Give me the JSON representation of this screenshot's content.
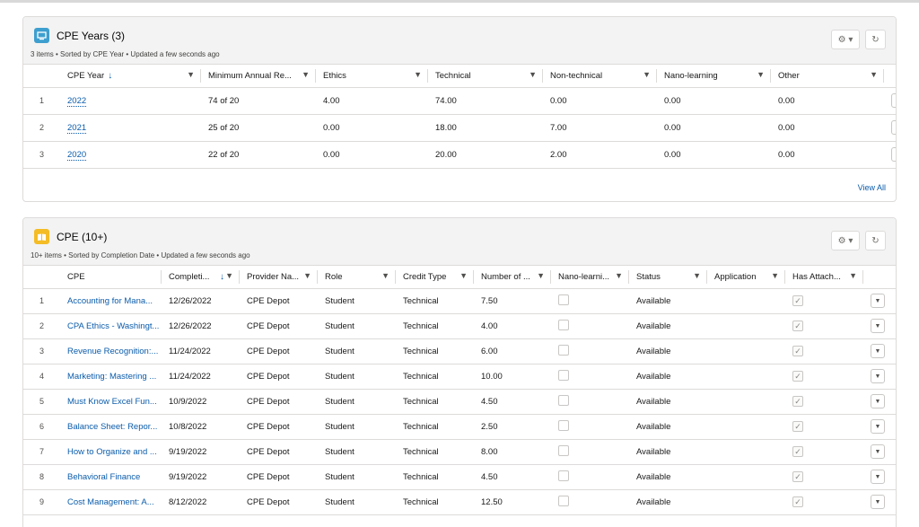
{
  "years_card": {
    "title": "CPE Years (3)",
    "subtitle": "3 items • Sorted by CPE Year • Updated a few seconds ago",
    "icon": "desktop-icon",
    "icon_color": "#3d9fcf",
    "settings_label": "⚙ ▾",
    "refresh_label": "↻",
    "columns": [
      "CPE Year",
      "Minimum Annual Re...",
      "Ethics",
      "Technical",
      "Non-technical",
      "Nano-learning",
      "Other"
    ],
    "sort_arrow": "↓",
    "rows": [
      {
        "num": "1",
        "year": "2022",
        "min": "74 of 20",
        "ethics": "4.00",
        "technical": "74.00",
        "nontech": "0.00",
        "nano": "0.00",
        "other": "0.00"
      },
      {
        "num": "2",
        "year": "2021",
        "min": "25 of 20",
        "ethics": "0.00",
        "technical": "18.00",
        "nontech": "7.00",
        "nano": "0.00",
        "other": "0.00"
      },
      {
        "num": "3",
        "year": "2020",
        "min": "22 of 20",
        "ethics": "0.00",
        "technical": "20.00",
        "nontech": "2.00",
        "nano": "0.00",
        "other": "0.00"
      }
    ],
    "view_all": "View All"
  },
  "cpe_card": {
    "title": "CPE (10+)",
    "subtitle": "10+ items • Sorted by Completion Date • Updated a few seconds ago",
    "icon": "book-icon",
    "icon_color": "#f4bc25",
    "settings_label": "⚙ ▾",
    "refresh_label": "↻",
    "columns": [
      "CPE",
      "Completi...",
      "Provider Na...",
      "Role",
      "Credit Type",
      "Number of ...",
      "Nano-learni...",
      "Status",
      "Application",
      "Has Attach..."
    ],
    "sort_arrow": "↓",
    "rows": [
      {
        "num": "1",
        "cpe": "Accounting for Mana...",
        "date": "12/26/2022",
        "provider": "CPE Depot",
        "role": "Student",
        "credit": "Technical",
        "number": "7.50",
        "nano": false,
        "status": "Available",
        "app": "",
        "attach": true
      },
      {
        "num": "2",
        "cpe": "CPA Ethics - Washingt...",
        "date": "12/26/2022",
        "provider": "CPE Depot",
        "role": "Student",
        "credit": "Technical",
        "number": "4.00",
        "nano": false,
        "status": "Available",
        "app": "",
        "attach": true
      },
      {
        "num": "3",
        "cpe": "Revenue Recognition:...",
        "date": "11/24/2022",
        "provider": "CPE Depot",
        "role": "Student",
        "credit": "Technical",
        "number": "6.00",
        "nano": false,
        "status": "Available",
        "app": "",
        "attach": true
      },
      {
        "num": "4",
        "cpe": "Marketing: Mastering ...",
        "date": "11/24/2022",
        "provider": "CPE Depot",
        "role": "Student",
        "credit": "Technical",
        "number": "10.00",
        "nano": false,
        "status": "Available",
        "app": "",
        "attach": true
      },
      {
        "num": "5",
        "cpe": "Must Know Excel Fun...",
        "date": "10/9/2022",
        "provider": "CPE Depot",
        "role": "Student",
        "credit": "Technical",
        "number": "4.50",
        "nano": false,
        "status": "Available",
        "app": "",
        "attach": true
      },
      {
        "num": "6",
        "cpe": "Balance Sheet: Repor...",
        "date": "10/8/2022",
        "provider": "CPE Depot",
        "role": "Student",
        "credit": "Technical",
        "number": "2.50",
        "nano": false,
        "status": "Available",
        "app": "",
        "attach": true
      },
      {
        "num": "7",
        "cpe": "How to Organize and ...",
        "date": "9/19/2022",
        "provider": "CPE Depot",
        "role": "Student",
        "credit": "Technical",
        "number": "8.00",
        "nano": false,
        "status": "Available",
        "app": "",
        "attach": true
      },
      {
        "num": "8",
        "cpe": "Behavioral Finance",
        "date": "9/19/2022",
        "provider": "CPE Depot",
        "role": "Student",
        "credit": "Technical",
        "number": "4.50",
        "nano": false,
        "status": "Available",
        "app": "",
        "attach": true
      },
      {
        "num": "9",
        "cpe": "Cost Management: A...",
        "date": "8/12/2022",
        "provider": "CPE Depot",
        "role": "Student",
        "credit": "Technical",
        "number": "12.50",
        "nano": false,
        "status": "Available",
        "app": "",
        "attach": true
      }
    ]
  }
}
